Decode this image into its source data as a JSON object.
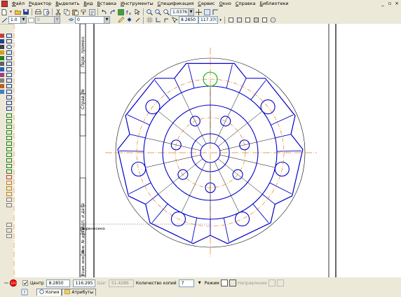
{
  "menu": {
    "items": [
      "Файл",
      "Редактор",
      "Выделить",
      "Вид",
      "Вставка",
      "Инструменты",
      "Спецификация",
      "Сервис",
      "Окно",
      "Справка",
      "Библиотеки"
    ]
  },
  "toolbar_top": {
    "zoom_value": "1.0376"
  },
  "toolbar_current": {
    "scale_value": "1.0",
    "style_value": "0",
    "layer_value": "0",
    "coord_x": "8.2850",
    "coord_y": "117.37("
  },
  "drawing": {
    "stamp_label": "Перенесено",
    "frame_texts": [
      "Перв. примен.",
      "Справ. №",
      "Подп. и дата",
      "Инв. № дубл.",
      "Взам. инв. №"
    ]
  },
  "property_bar": {
    "center_label": "Центр",
    "center_x": "8.2850",
    "center_y": "116.295",
    "step_label": "Шаг",
    "step_value": "51.4286",
    "copies_label": "Количество копий",
    "copies_value": "7",
    "mode_label": "Режим",
    "direction_label": "Направление"
  },
  "tabs": [
    {
      "label": "Копия",
      "active": true
    },
    {
      "label": "Атрибуты",
      "active": false
    }
  ],
  "colors": {
    "geometry": "#0000c8",
    "thin": "#000000",
    "axis": "#e08020",
    "selected": "#00b000"
  }
}
